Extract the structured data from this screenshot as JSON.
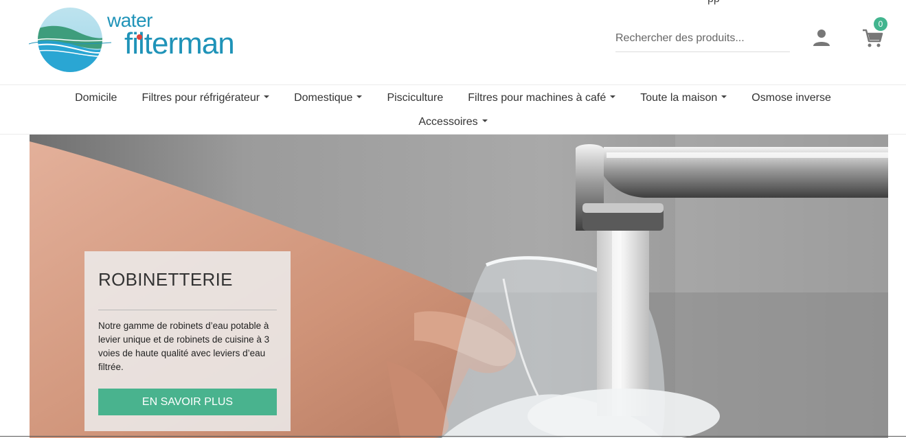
{
  "brand": {
    "word_top": "water",
    "word_bottom": "filterman",
    "colors": {
      "brand_blue": "#1f93b8",
      "brand_green": "#3e9d7c",
      "dot_red": "#e0433b"
    }
  },
  "header": {
    "top_cut_text": "pp",
    "search": {
      "placeholder": "Rechercher des produits...",
      "value": ""
    },
    "account_icon": "user-icon",
    "cart": {
      "icon": "cart-icon",
      "count": "0",
      "badge_color": "#42b58f"
    }
  },
  "nav": {
    "items": [
      {
        "label": "Domicile",
        "dropdown": false
      },
      {
        "label": "Filtres pour réfrigérateur",
        "dropdown": true
      },
      {
        "label": "Domestique",
        "dropdown": true
      },
      {
        "label": "Pisciculture",
        "dropdown": false
      },
      {
        "label": "Filtres pour machines à café",
        "dropdown": true
      },
      {
        "label": "Toute la maison",
        "dropdown": true
      },
      {
        "label": "Osmose inverse",
        "dropdown": false
      },
      {
        "label": "Accessoires",
        "dropdown": true
      }
    ]
  },
  "hero": {
    "title": "ROBINETTERIE",
    "text": "Notre gamme de robinets d’eau potable à levier unique et de robinets de cuisine à 3 voies de haute qualité avec leviers d’eau filtrée.",
    "button_label": "EN SAVOIR PLUS",
    "button_color": "#49b38e"
  }
}
